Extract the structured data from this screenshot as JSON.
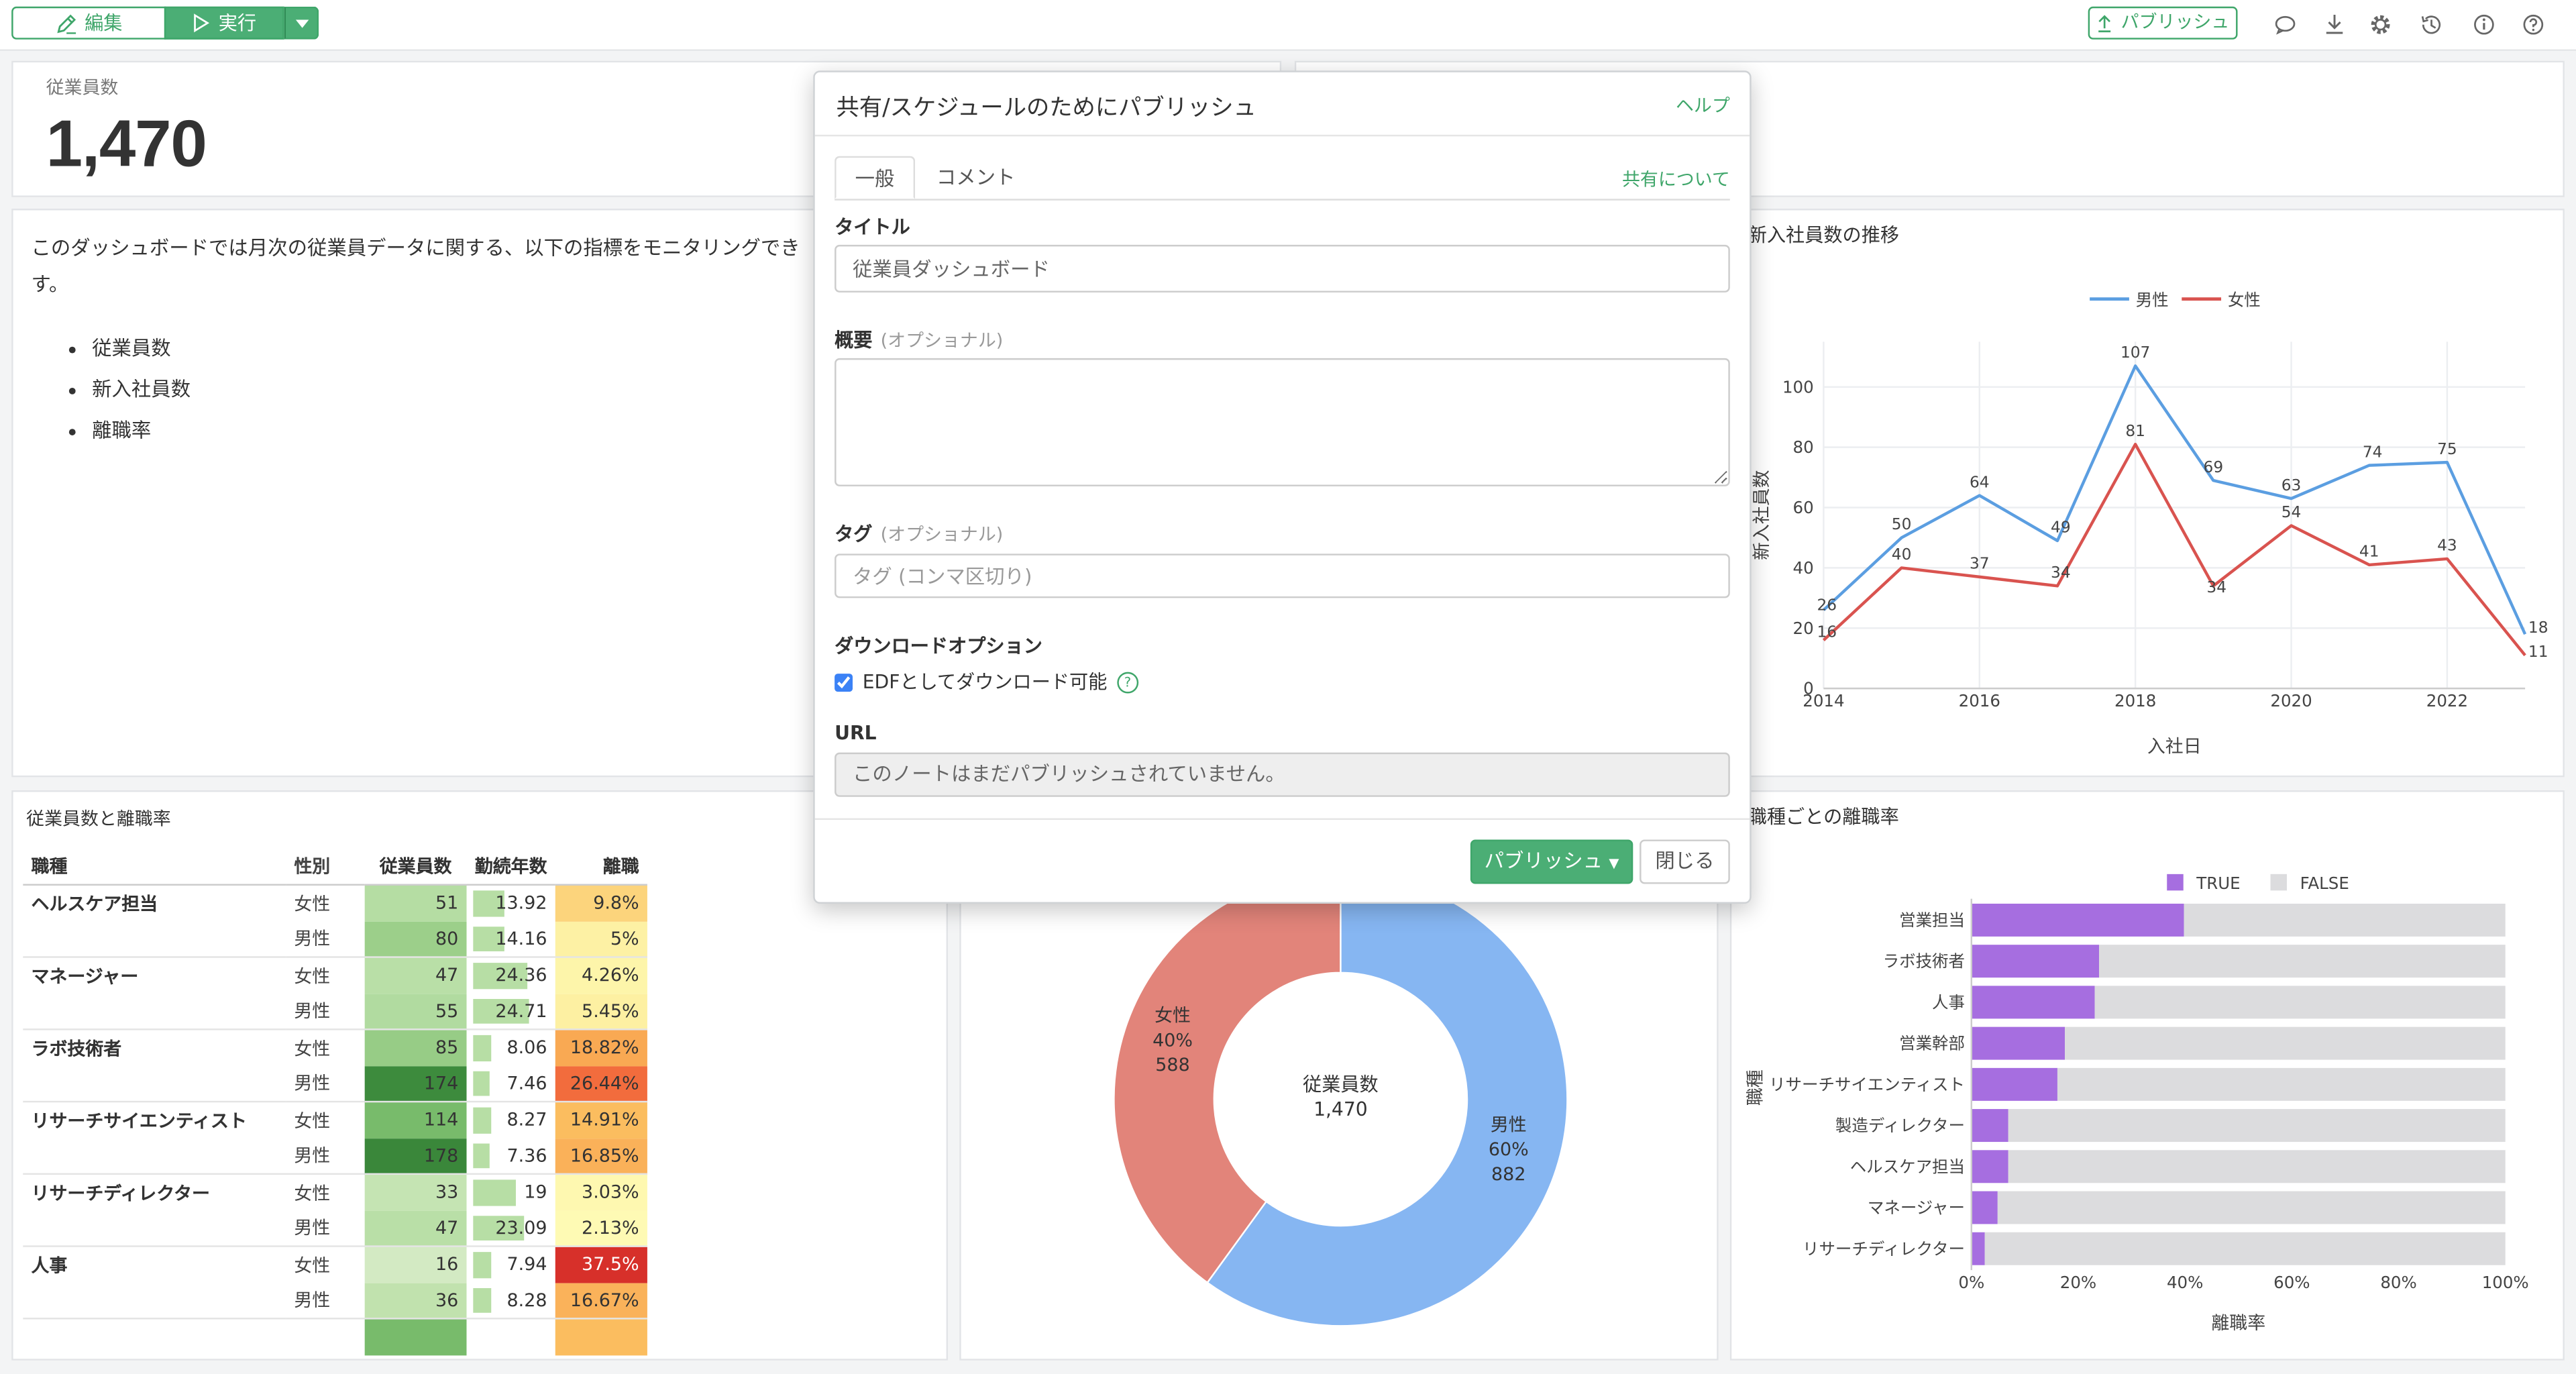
{
  "toolbar": {
    "edit_label": "編集",
    "run_label": "実行",
    "publish_label": "パブリッシュ",
    "icons": [
      "comment-icon",
      "download-icon",
      "gear-icon",
      "history-icon",
      "info-icon",
      "help-icon"
    ]
  },
  "kpi": {
    "label": "従業員数",
    "value": "1,470"
  },
  "description": {
    "text": "このダッシュボードでは月次の従業員データに関する、以下の指標をモニタリングできます。",
    "text_visible": "このダッシュボードでは月次の従業員データに関する、以下の指標をモニタリングでき",
    "text_line2": "す。",
    "items": [
      "従業員数",
      "新入社員数",
      "離職率"
    ]
  },
  "table_panel": {
    "title": "従業員数と離職率",
    "headers": [
      "職種",
      "性別",
      "従業員数",
      "勤続年数",
      "離職"
    ],
    "rows": [
      {
        "job": "ヘルスケア担当",
        "sex": "女性",
        "count": "51",
        "tenure": "13.92",
        "tenure_v": 13.92,
        "rate": "9.8%",
        "count_color": "#b5dda3",
        "rate_color": "#fcd47c"
      },
      {
        "job": "",
        "sex": "男性",
        "count": "80",
        "tenure": "14.16",
        "tenure_v": 14.16,
        "rate": "5%",
        "count_color": "#9ccf8a",
        "rate_color": "#fdf1a4"
      },
      {
        "job": "マネージャー",
        "sex": "女性",
        "count": "47",
        "tenure": "24.36",
        "tenure_v": 24.36,
        "rate": "4.26%",
        "count_color": "#b9dfa7",
        "rate_color": "#fdf5aa"
      },
      {
        "job": "",
        "sex": "男性",
        "count": "55",
        "tenure": "24.71",
        "tenure_v": 24.71,
        "rate": "5.45%",
        "count_color": "#b1dba0",
        "rate_color": "#fdf0a2"
      },
      {
        "job": "ラボ技術者",
        "sex": "女性",
        "count": "85",
        "tenure": "8.06",
        "tenure_v": 8.06,
        "rate": "18.82%",
        "count_color": "#97cc86",
        "rate_color": "#f9a953"
      },
      {
        "job": "",
        "sex": "男性",
        "count": "174",
        "tenure": "7.46",
        "tenure_v": 7.46,
        "rate": "26.44%",
        "count_color": "#3d8b3d",
        "rate_color": "#f26c3d"
      },
      {
        "job": "リサーチサイエンティスト",
        "sex": "女性",
        "count": "114",
        "tenure": "8.27",
        "tenure_v": 8.27,
        "rate": "14.91%",
        "count_color": "#78bb6b",
        "rate_color": "#fbbd5f"
      },
      {
        "job": "",
        "sex": "男性",
        "count": "178",
        "tenure": "7.36",
        "tenure_v": 7.36,
        "rate": "16.85%",
        "count_color": "#3a873a",
        "rate_color": "#fab159"
      },
      {
        "job": "リサーチディレクター",
        "sex": "女性",
        "count": "33",
        "tenure": "19",
        "tenure_v": 19,
        "rate": "3.03%",
        "count_color": "#c5e4b3",
        "rate_color": "#fef8b0"
      },
      {
        "job": "",
        "sex": "男性",
        "count": "47",
        "tenure": "23.09",
        "tenure_v": 23.09,
        "rate": "2.13%",
        "count_color": "#b9dfa7",
        "rate_color": "#fefab4"
      },
      {
        "job": "人事",
        "sex": "女性",
        "count": "16",
        "tenure": "7.94",
        "tenure_v": 7.94,
        "rate": "37.5%",
        "count_color": "#d3eac3",
        "rate_color": "#d7302a"
      },
      {
        "job": "",
        "sex": "男性",
        "count": "36",
        "tenure": "8.28",
        "tenure_v": 8.28,
        "rate": "16.67%",
        "count_color": "#c1e2ae",
        "rate_color": "#fab25a"
      }
    ]
  },
  "line_panel": {
    "title": "新入社員数の推移"
  },
  "bar_panel": {
    "title": "職種ごとの離職率"
  },
  "modal": {
    "title": "共有/スケジュールのためにパブリッシュ",
    "help": "ヘルプ",
    "tabs": [
      "一般",
      "コメント"
    ],
    "about_sharing": "共有について",
    "title_label": "タイトル",
    "title_value": "従業員ダッシュボード",
    "summary_label": "概要",
    "optional": "(オプショナル)",
    "tag_label": "タグ",
    "tag_placeholder": "タグ (コンマ区切り)",
    "download_label": "ダウンロードオプション",
    "edf_label": "EDFとしてダウンロード可能",
    "url_label": "URL",
    "url_value": "このノートはまだパブリッシュされていません。",
    "publish_button": "パブリッシュ",
    "close_button": "閉じる"
  },
  "chart_data": [
    {
      "type": "line",
      "title": "新入社員数の推移",
      "xlabel": "入社日",
      "ylabel": "新入社員数",
      "x": [
        2014,
        2015,
        2016,
        2017,
        2018,
        2019,
        2020,
        2021,
        2022,
        2023
      ],
      "series": [
        {
          "name": "男性",
          "color": "#5b9ee1",
          "values": [
            26,
            50,
            64,
            49,
            107,
            69,
            63,
            74,
            75,
            18
          ]
        },
        {
          "name": "女性",
          "color": "#d9534f",
          "values": [
            16,
            40,
            37,
            34,
            81,
            34,
            54,
            41,
            43,
            11
          ]
        }
      ],
      "xticks": [
        2014,
        2016,
        2018,
        2020,
        2022
      ],
      "yticks": [
        0,
        20,
        40,
        60,
        80,
        100
      ],
      "ylim": [
        0,
        115
      ],
      "legend": "top",
      "grid": true
    },
    {
      "type": "pie",
      "title": "",
      "center_label": "従業員数",
      "center_value": "1,470",
      "slices": [
        {
          "label": "男性",
          "value": 882,
          "percent": "60%",
          "color": "#86b6f2"
        },
        {
          "label": "女性",
          "value": 588,
          "percent": "40%",
          "color": "#e2847a"
        }
      ]
    },
    {
      "type": "bar",
      "title": "職種ごとの離職率",
      "xlabel": "離職率",
      "ylabel": "職種",
      "orientation": "horizontal",
      "stacked": true,
      "categories": [
        "営業担当",
        "ラボ技術者",
        "人事",
        "営業幹部",
        "リサーチサイエンティスト",
        "製造ディレクター",
        "ヘルスケア担当",
        "マネージャー",
        "リサーチディレクター"
      ],
      "series": [
        {
          "name": "TRUE",
          "color": "#a66ee0",
          "values": [
            0.398,
            0.239,
            0.231,
            0.175,
            0.161,
            0.069,
            0.069,
            0.049,
            0.025
          ]
        },
        {
          "name": "FALSE",
          "color": "#dcdcde",
          "values": [
            0.602,
            0.761,
            0.769,
            0.825,
            0.839,
            0.931,
            0.931,
            0.951,
            0.975
          ]
        }
      ],
      "xticks": [
        "0%",
        "20%",
        "40%",
        "60%",
        "80%",
        "100%"
      ],
      "xlim": [
        0,
        1
      ],
      "legend": "top"
    }
  ]
}
